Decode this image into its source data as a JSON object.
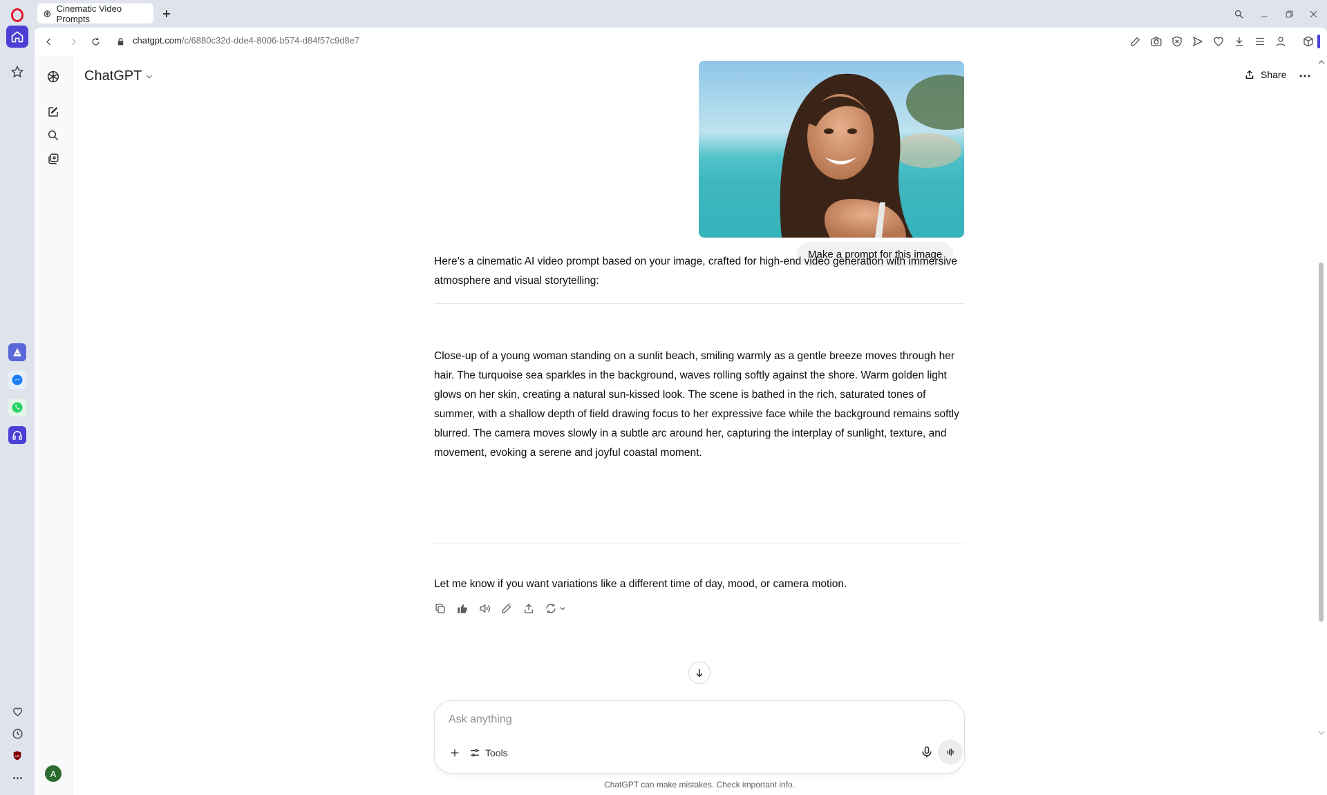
{
  "browser": {
    "tab_title": "Cinematic Video Prompts",
    "url_domain": "chatgpt.com",
    "url_path": "/c/6880c32d-dde4-8006-b574-d84f57c9d8e7"
  },
  "header": {
    "model_name": "ChatGPT",
    "share_label": "Share"
  },
  "conversation": {
    "user_message": "Make a prompt for this image",
    "response_intro": "Here’s a cinematic AI video prompt based on your image, crafted for high-end video generation with immersive atmosphere and visual storytelling:",
    "response_prompt": "Close-up of a young woman standing on a sunlit beach, smiling warmly as a gentle breeze moves through her hair. The turquoise sea sparkles in the background, waves rolling softly against the shore. Warm golden light glows on her skin, creating a natural sun-kissed look. The scene is bathed in the rich, saturated tones of summer, with a shallow depth of field drawing focus to her expressive face while the background remains softly blurred. The camera moves slowly in a subtle arc around her, capturing the interplay of sunlight, texture, and movement, evoking a serene and joyful coastal moment.",
    "response_outro": "Let me know if you want variations like a different time of day, mood, or camera motion."
  },
  "composer": {
    "placeholder": "Ask anything",
    "tools_label": "Tools"
  },
  "sidebar": {
    "avatar_initial": "A"
  },
  "footer": {
    "disclaimer": "ChatGPT can make mistakes. Check important info."
  },
  "colors": {
    "opera_red": "#e6192e",
    "home_accent": "#4b3fd6",
    "avatar_bg": "#2c6b2f"
  }
}
